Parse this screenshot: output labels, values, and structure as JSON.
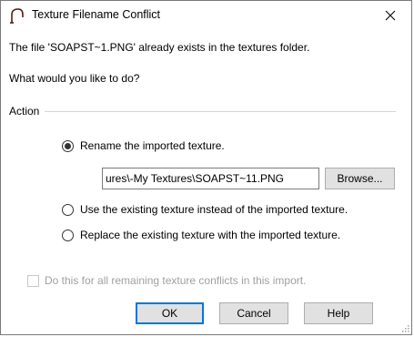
{
  "window": {
    "title": "Texture Filename Conflict",
    "close_icon": "close-icon",
    "app_icon": "arch-icon"
  },
  "message": {
    "line1": "The file 'SOAPST~1.PNG' already exists in the textures folder.",
    "line2": "What would you like to do?"
  },
  "action_group": {
    "label": "Action",
    "options": [
      {
        "label": "Rename the imported texture.",
        "checked": true
      },
      {
        "label": "Use the existing texture instead of the imported texture.",
        "checked": false
      },
      {
        "label": "Replace the existing texture with the imported texture.",
        "checked": false
      }
    ],
    "rename_path": "ures\\-My Textures\\SOAPST~11.PNG",
    "browse_label": "Browse..."
  },
  "apply_all": {
    "label": "Do this for all remaining texture conflicts in this import.",
    "checked": false,
    "enabled": false
  },
  "buttons": {
    "ok": "OK",
    "cancel": "Cancel",
    "help": "Help"
  },
  "colors": {
    "default_button_border": "#0078d7",
    "button_face": "#e1e1e1",
    "disabled_text": "#a0a0a0"
  }
}
